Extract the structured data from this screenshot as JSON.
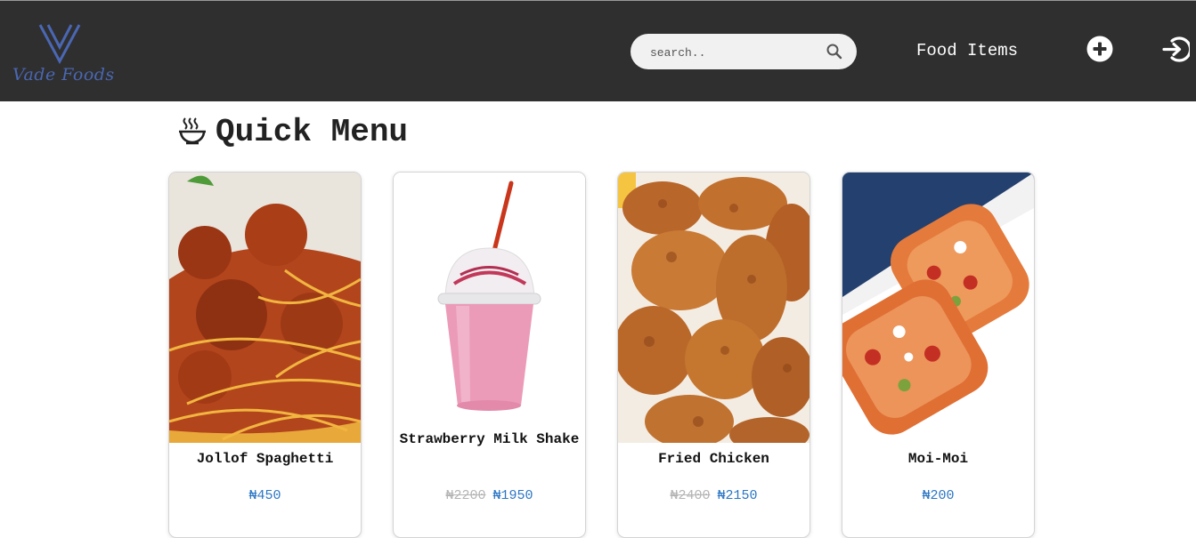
{
  "brand": {
    "name": "Vade Foods",
    "color": "#4a67b3"
  },
  "header": {
    "search_placeholder": "search..",
    "nav_label": "Food Items",
    "background": "#2f2f2f"
  },
  "page": {
    "title": "Quick Menu"
  },
  "menu": [
    {
      "name": "Jollof Spaghetti",
      "price": "₦450",
      "old_price": ""
    },
    {
      "name": "Strawberry Milk Shake",
      "price": "₦1950",
      "old_price": "₦2200"
    },
    {
      "name": "Fried Chicken",
      "price": "₦2150",
      "old_price": "₦2400"
    },
    {
      "name": "Moi-Moi",
      "price": "₦200",
      "old_price": ""
    }
  ],
  "colors": {
    "price": "#2b76c4",
    "old_price": "#b4b4b4"
  }
}
